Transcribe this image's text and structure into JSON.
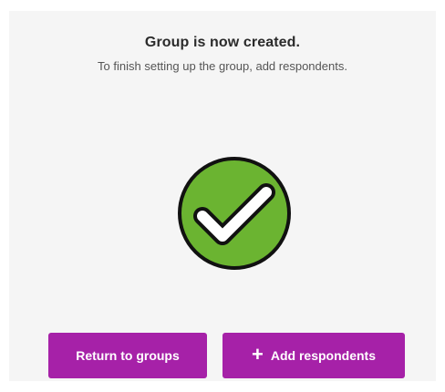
{
  "dialog": {
    "title": "Group is now created.",
    "subtitle": "To finish setting up the group, add respondents."
  },
  "status_icon": {
    "name": "check-circle-icon",
    "fill_color": "#6bb431",
    "outline_color": "#111111",
    "check_color": "#ffffff"
  },
  "actions": {
    "return_label": "Return to groups",
    "add_label": "Add respondents",
    "add_icon": "plus-icon"
  },
  "colors": {
    "accent": "#a621a8",
    "panel_background": "#f5f5f5"
  }
}
